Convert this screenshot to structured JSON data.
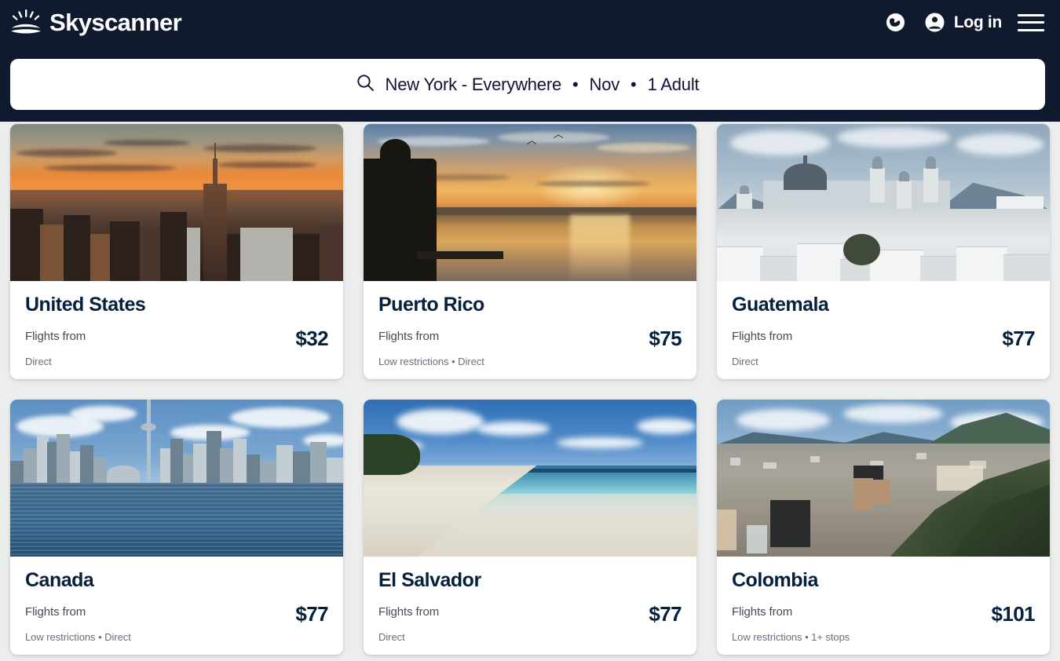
{
  "brand": {
    "name": "Skyscanner",
    "logo_icon": "sunrise-logo-icon",
    "header_bg": "#0f1a2f",
    "page_bg": "#eceded"
  },
  "navbar": {
    "globe_icon": "globe-icon",
    "account_icon": "account-circle-icon",
    "login_label": "Log in",
    "menu_icon": "hamburger-menu-icon"
  },
  "search": {
    "icon": "search-icon",
    "route": "New York - Everywhere",
    "separator_1": "•",
    "month": "Nov",
    "separator_2": "•",
    "travellers": "1 Adult",
    "full_text": "New York - Everywhere • Nov • 1 Adult"
  },
  "results": {
    "flights_from_label": "Flights from",
    "cards": [
      {
        "destination": "United States",
        "from_label": "Flights from",
        "price": "$32",
        "meta": "Direct",
        "photo": "new-york-city-skyline-sunset"
      },
      {
        "destination": "Puerto Rico",
        "from_label": "Flights from",
        "price": "$75",
        "meta": "Low restrictions • Direct",
        "photo": "puerto-rico-bay-sunset"
      },
      {
        "destination": "Guatemala",
        "from_label": "Flights from",
        "price": "$77",
        "meta": "Direct",
        "photo": "guatemala-city-cathedral"
      },
      {
        "destination": "Canada",
        "from_label": "Flights from",
        "price": "$77",
        "meta": "Low restrictions • Direct",
        "photo": "toronto-skyline-cn-tower"
      },
      {
        "destination": "El Salvador",
        "from_label": "Flights from",
        "price": "$77",
        "meta": "Direct",
        "photo": "el-salvador-white-sand-beach"
      },
      {
        "destination": "Colombia",
        "from_label": "Flights from",
        "price": "$101",
        "meta": "Low restrictions • 1+ stops",
        "photo": "bogota-cityscape-hills"
      }
    ]
  }
}
